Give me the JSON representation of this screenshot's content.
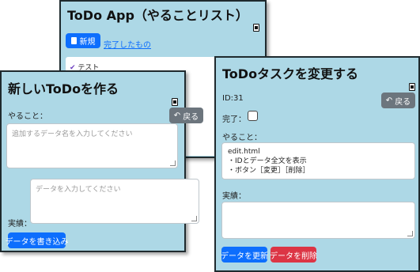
{
  "list_window": {
    "title": "ToDo App（やることリスト）",
    "new_button": "新規",
    "completed_link": "完了したもの",
    "items": [
      "テスト"
    ]
  },
  "create_window": {
    "title": "新しいToDoを作る",
    "back_button": "戻る",
    "task_label": "やること：",
    "task_placeholder": "追加するデータ名を入力してください",
    "result_label": "実績：",
    "result_placeholder": "データを入力してください",
    "submit_button": "データを書き込み"
  },
  "edit_window": {
    "title": "ToDoタスクを変更する",
    "id_text": "ID:31",
    "back_button": "戻る",
    "done_label": "完了：",
    "task_label": "やること：",
    "task_lines": [
      "edit.html",
      "・IDとデータ全文を表示",
      "・ボタン［変更］［削除］"
    ],
    "result_label": "実績：",
    "update_button": "データを更新",
    "delete_button": "データを削除"
  }
}
